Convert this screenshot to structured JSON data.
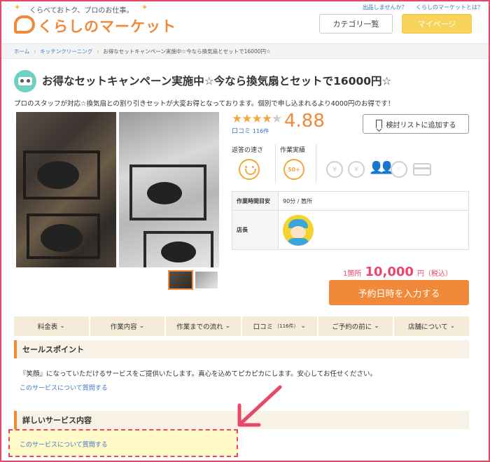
{
  "header": {
    "tagline": "くらべておトク、プロのお仕事。",
    "logo_text": "くらしのマーケット",
    "top_links": [
      "出品しませんか？",
      "くらしのマーケットとは？"
    ],
    "category_button": "カテゴリ一覧",
    "mypage_button": "マイページ"
  },
  "breadcrumb": [
    "ホーム",
    "キッチンクリーニング",
    "お得なセットキャンペーン実施中☆今なら換気扇とセットで16000円☆"
  ],
  "service": {
    "title": "お得なセットキャンペーン実施中☆今なら換気扇とセットで16000円☆",
    "subtitle": "プロのスタッフが対応☆換気扇との割り引きセットが大変お得となっております。個別で申し込まれるより4000円のお得です！",
    "rating_stars": 4,
    "rating_stars_max": 5,
    "review_label": "口コミ",
    "review_count": "116件",
    "score": "4.88",
    "wishlist_button": "検討リストに追加する",
    "reply_speed_label": "返答の速さ",
    "works_label": "作業実績",
    "works_badge": "50+",
    "table": [
      {
        "label": "作業時間目安",
        "value": "90分 / 箇所"
      },
      {
        "label": "店長",
        "value": ""
      }
    ],
    "price_prefix": "1箇所",
    "price": "10,000",
    "price_suffix": "円（税込）",
    "reserve_button": "予約日時を入力する"
  },
  "tabs": [
    {
      "label": "料金表",
      "count": ""
    },
    {
      "label": "作業内容",
      "count": ""
    },
    {
      "label": "作業までの流れ",
      "count": ""
    },
    {
      "label": "口コミ",
      "count": "（116件）"
    },
    {
      "label": "ご予約の前に",
      "count": ""
    },
    {
      "label": "店舗について",
      "count": ""
    }
  ],
  "sections": {
    "sales_title": "セールスポイント",
    "sales_text": "『笑顔』になっていただけるサービスをご提供いたします。真心を込めてピカピカにします。安心してお任せください。",
    "question_link_1": "このサービスについて質問する",
    "detail_title": "詳しいサービス内容",
    "question_link_2": "このサービスについて質問する"
  },
  "colors": {
    "accent_orange": "#f08a3a",
    "highlight_pink": "#e8476a",
    "link_blue": "#3b74c4",
    "tab_bg": "#f4ecd9"
  },
  "icons": [
    "star-icon",
    "bookmark-icon",
    "smile-icon",
    "yen-icon",
    "people-icon",
    "card-icon",
    "chevron-down-icon",
    "arrow-icon"
  ]
}
